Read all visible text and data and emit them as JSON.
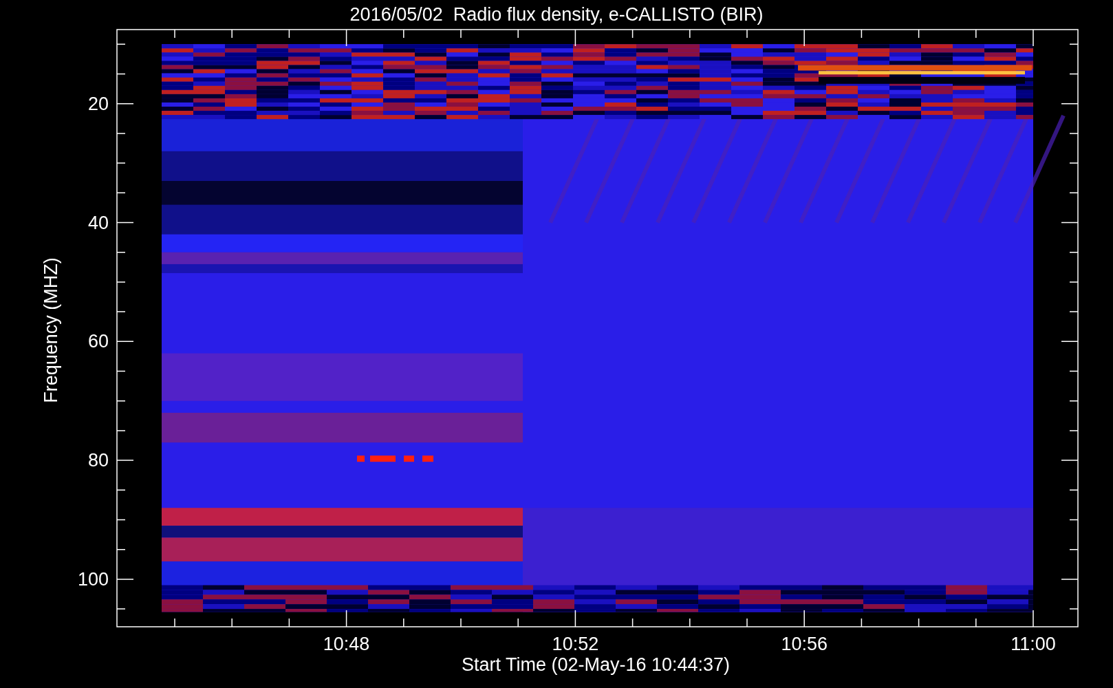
{
  "title": "2016/05/02  Radio flux density, e-CALLISTO (BIR)",
  "y_axis": {
    "label": "Frequency (MHZ)",
    "ticks": [
      "20",
      "40",
      "60",
      "80",
      "100"
    ]
  },
  "x_axis": {
    "label": "Start Time (02-May-16 10:44:37)",
    "ticks": [
      "10:48",
      "10:52",
      "10:56",
      "11:00"
    ]
  }
}
